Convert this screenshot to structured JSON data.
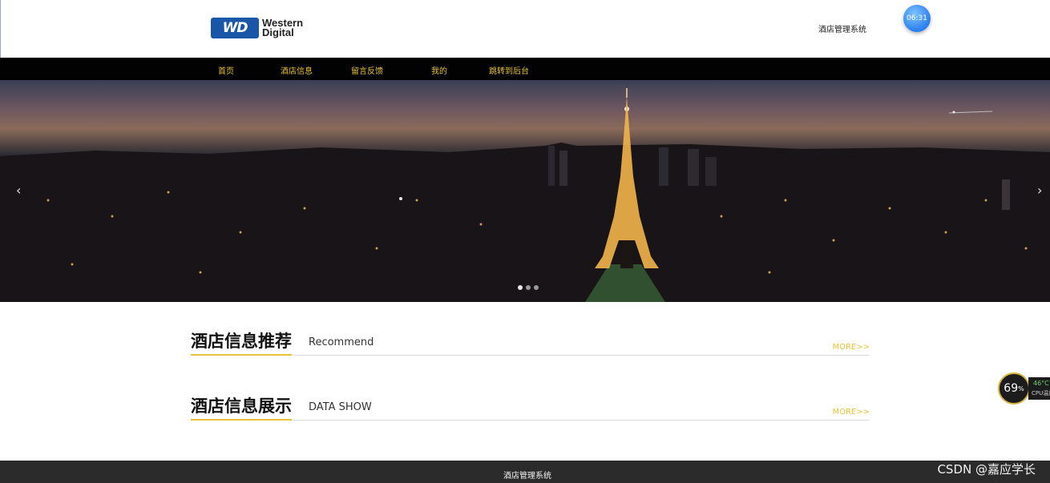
{
  "header": {
    "logo_mark": "WD",
    "logo_line1": "Western",
    "logo_line2": "Digital",
    "site_title": "酒店管理系统",
    "clock": "06:31"
  },
  "nav": {
    "items": [
      "首页",
      "酒店信息",
      "留言反馈",
      "我的",
      "跳转到后台"
    ]
  },
  "banner": {
    "prev_icon": "chevron-left-icon",
    "next_icon": "chevron-right-icon",
    "prev_glyph": "‹",
    "next_glyph": "›",
    "slides": 3,
    "active_slide": 1
  },
  "sections": [
    {
      "title_cn": "酒店信息推荐",
      "title_en": "Recommend",
      "more": "MORE>>"
    },
    {
      "title_cn": "酒店信息展示",
      "title_en": "DATA SHOW",
      "more": "MORE>>"
    }
  ],
  "footer": {
    "text": "酒店管理系统",
    "watermark": "CSDN @嘉应学长"
  },
  "cpu_widget": {
    "percent": "69",
    "unit": "%",
    "temperature": "46°C",
    "label": "CPU温度"
  },
  "colors": {
    "accent": "#e8c33a",
    "nav_bg": "#020202",
    "footer_bg": "#2b2b2b",
    "logo_blue": "#1a56a8"
  }
}
